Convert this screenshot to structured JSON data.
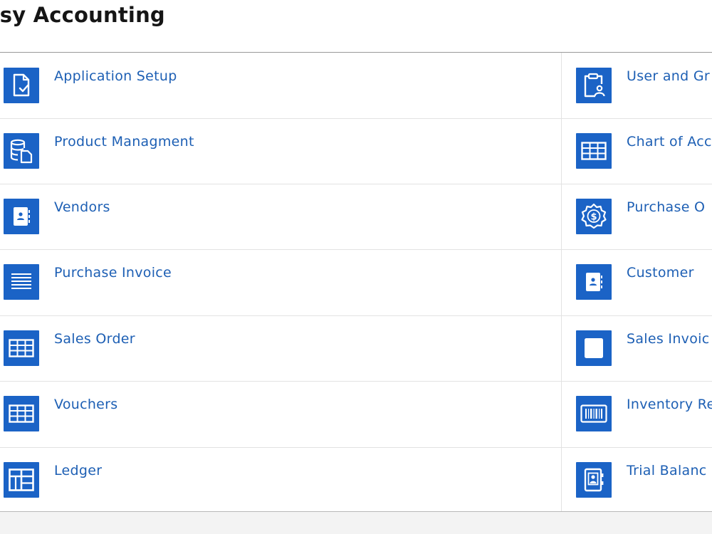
{
  "app": {
    "title": "asy Accounting"
  },
  "colors": {
    "accent": "#1b63c6",
    "link_text": "#1d5fb4",
    "title_text": "#151515"
  },
  "modules": {
    "left": [
      {
        "label": "Application Setup",
        "icon": "document-check-icon"
      },
      {
        "label": "Product Managment",
        "icon": "database-file-icon"
      },
      {
        "label": "Vendors",
        "icon": "contact-book-icon"
      },
      {
        "label": "Purchase Invoice",
        "icon": "lines-list-icon"
      },
      {
        "label": "Sales Order",
        "icon": "table-grid-icon"
      },
      {
        "label": "Vouchers",
        "icon": "table-grid-icon"
      },
      {
        "label": "Ledger",
        "icon": "ledger-grid-icon"
      }
    ],
    "right": [
      {
        "label": "User and Gr",
        "icon": "clipboard-user-icon"
      },
      {
        "label": "Chart of Acc",
        "icon": "table-grid-icon"
      },
      {
        "label": "Purchase O",
        "icon": "dollar-badge-icon"
      },
      {
        "label": "Customer",
        "icon": "contact-book-icon"
      },
      {
        "label": "Sales Invoic",
        "icon": "blank-page-icon"
      },
      {
        "label": "Inventory Re",
        "icon": "barcode-icon"
      },
      {
        "label": "Trial Balanc",
        "icon": "contact-frame-icon"
      }
    ]
  }
}
